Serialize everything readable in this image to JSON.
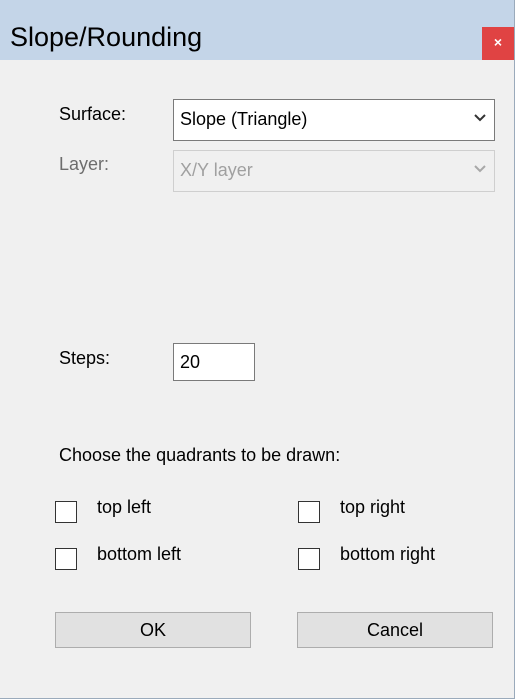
{
  "window": {
    "title": "Slope/Rounding",
    "close_glyph": "×"
  },
  "surface": {
    "label": "Surface:",
    "value": "Slope (Triangle)"
  },
  "layer": {
    "label": "Layer:",
    "value": "X/Y layer"
  },
  "steps": {
    "label": "Steps:",
    "value": "20"
  },
  "quadrants": {
    "heading": "Choose the quadrants to be drawn:",
    "top_left": "top left",
    "top_right": "top right",
    "bottom_left": "bottom left",
    "bottom_right": "bottom right"
  },
  "buttons": {
    "ok": "OK",
    "cancel": "Cancel"
  },
  "colors": {
    "titlebar": "#c4d5e8",
    "close_button": "#e04343",
    "dialog_background": "#f0f0f0"
  }
}
